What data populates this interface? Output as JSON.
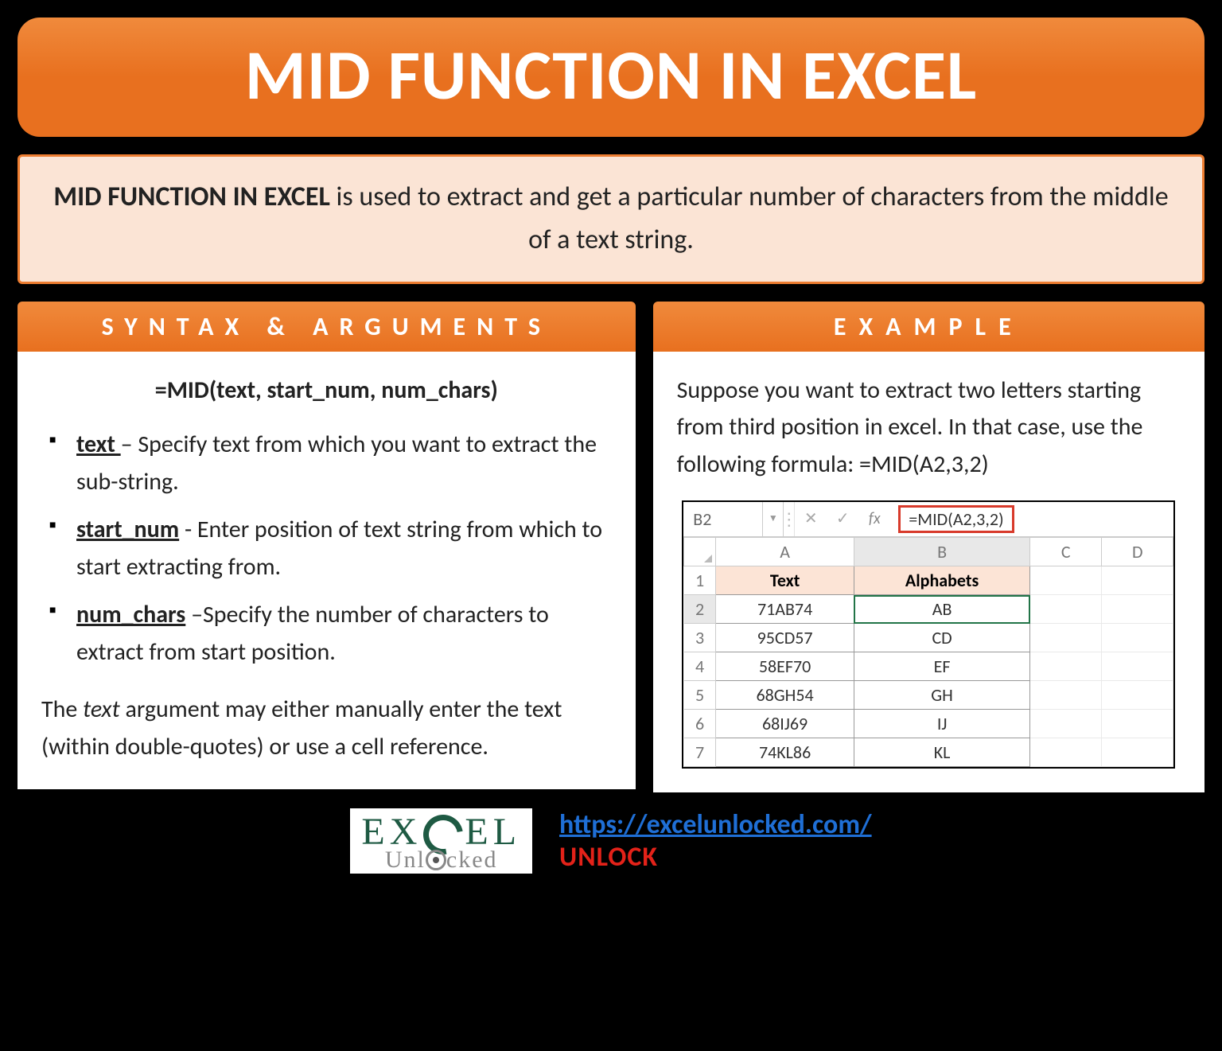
{
  "title": "MID FUNCTION IN EXCEL",
  "intro": {
    "bold": "MID FUNCTION IN EXCEL",
    "rest": " is used to extract and get a particular number of characters from the middle of a text string."
  },
  "syntax": {
    "header": "SYNTAX & ARGUMENTS",
    "formula": "=MID(text, start_num, num_chars)",
    "args": [
      {
        "name": "text ",
        "desc": "– Specify text from which you want to extract the sub-string."
      },
      {
        "name": "start_num",
        "desc": " - Enter position of text string from which to start extracting from."
      },
      {
        "name": "num_chars",
        "desc": " –Specify the number of characters to extract from start position."
      }
    ],
    "note_pre": "The ",
    "note_italic": "text",
    "note_post": " argument may either manually enter the text (within double-quotes) or use a cell reference."
  },
  "example": {
    "header": "EXAMPLE",
    "text": "Suppose you want to extract two letters starting from third position in excel. In that case, use the following formula: =MID(A2,3,2)",
    "fx_cell": "B2",
    "fx_formula": "=MID(A2,3,2)",
    "columns": [
      "A",
      "B",
      "C",
      "D"
    ],
    "headers": {
      "A": "Text",
      "B": "Alphabets"
    },
    "rows": [
      {
        "n": "1"
      },
      {
        "n": "2",
        "A": "71AB74",
        "B": "AB"
      },
      {
        "n": "3",
        "A": "95CD57",
        "B": "CD"
      },
      {
        "n": "4",
        "A": "58EF70",
        "B": "EF"
      },
      {
        "n": "5",
        "A": "68GH54",
        "B": "GH"
      },
      {
        "n": "6",
        "A": "68IJ69",
        "B": "IJ"
      },
      {
        "n": "7",
        "A": "74KL86",
        "B": "KL"
      }
    ]
  },
  "footer": {
    "logo_top": "EX EL",
    "logo_bottom_pre": "Unl",
    "logo_bottom_post": "cked",
    "url": "https://excelunlocked.com/",
    "unlock": "UNLOCK"
  }
}
